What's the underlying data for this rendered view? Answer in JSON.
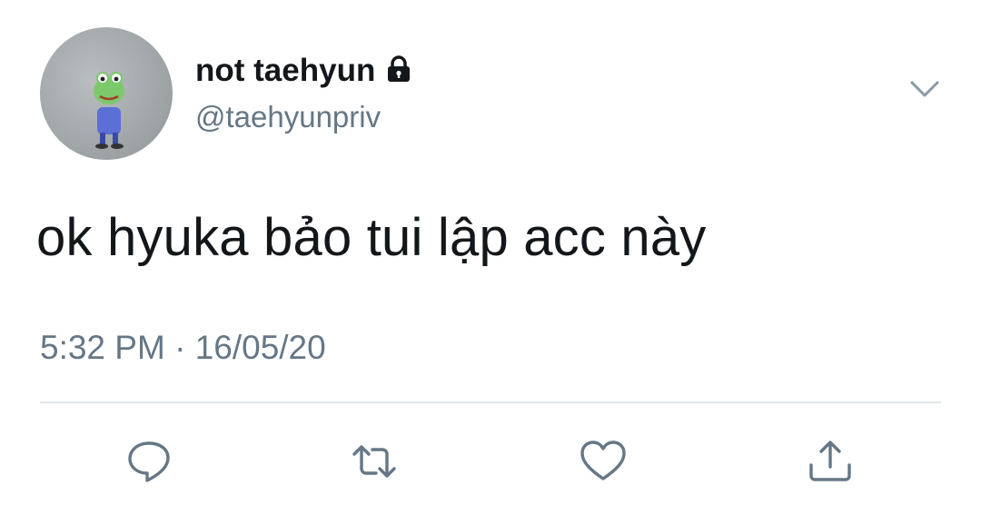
{
  "author": {
    "display_name": "not taehyun",
    "handle": "@taehyunpriv",
    "protected": true
  },
  "tweet": {
    "text": "ok hyuka bảo tui lập acc này",
    "time": "5:32 PM",
    "separator": "·",
    "date": "16/05/20"
  },
  "icons": {
    "lock": "lock-icon",
    "menu": "chevron-down-icon",
    "reply": "reply-icon",
    "retweet": "retweet-icon",
    "like": "heart-icon",
    "share": "share-icon"
  },
  "colors": {
    "text": "#14171a",
    "secondary": "#657786",
    "icon": "#657786",
    "divider": "#e1e8ed"
  }
}
